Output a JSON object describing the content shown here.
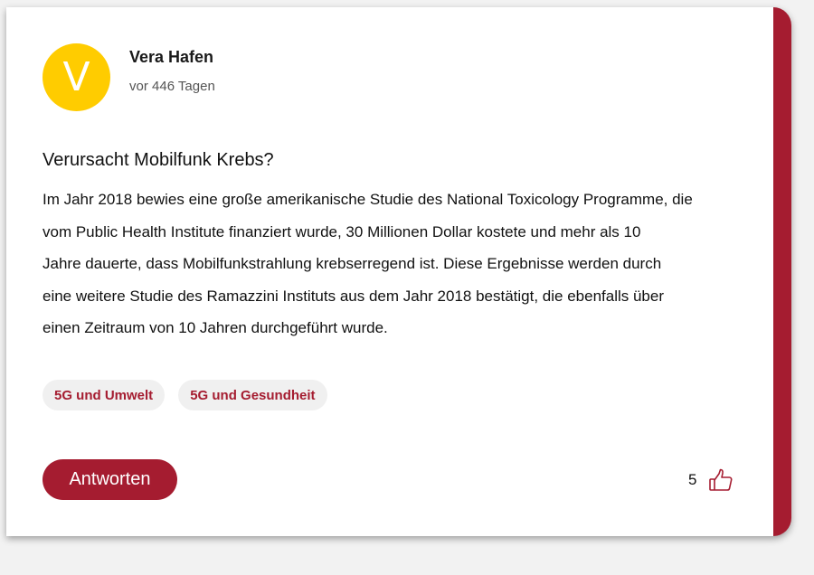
{
  "colors": {
    "accent": "#a51c30",
    "avatar_bg": "#ffcc00",
    "tag_bg": "#f0f0f0"
  },
  "author": {
    "initial": "V",
    "name": "Vera Hafen",
    "time": "vor 446 Tagen"
  },
  "post": {
    "title": "Verursacht Mobilfunk Krebs?",
    "body": "Im Jahr 2018 bewies eine große amerikanische Studie des National Toxicology Programme, die\nvom Public Health Institute finanziert wurde, 30 Millionen Dollar kostete und mehr als 10\nJahre dauerte, dass Mobilfunkstrahlung krebserregend ist.  Diese Ergebnisse werden durch\neine weitere Studie des Ramazzini Instituts aus dem Jahr 2018 bestätigt, die ebenfalls über\neinen Zeitraum von 10 Jahren durchgeführt wurde."
  },
  "tags": [
    {
      "label": "5G und Umwelt"
    },
    {
      "label": "5G und Gesundheit"
    }
  ],
  "actions": {
    "reply_label": "Antworten",
    "like_count": "5",
    "like_icon": "thumbs-up-icon"
  }
}
